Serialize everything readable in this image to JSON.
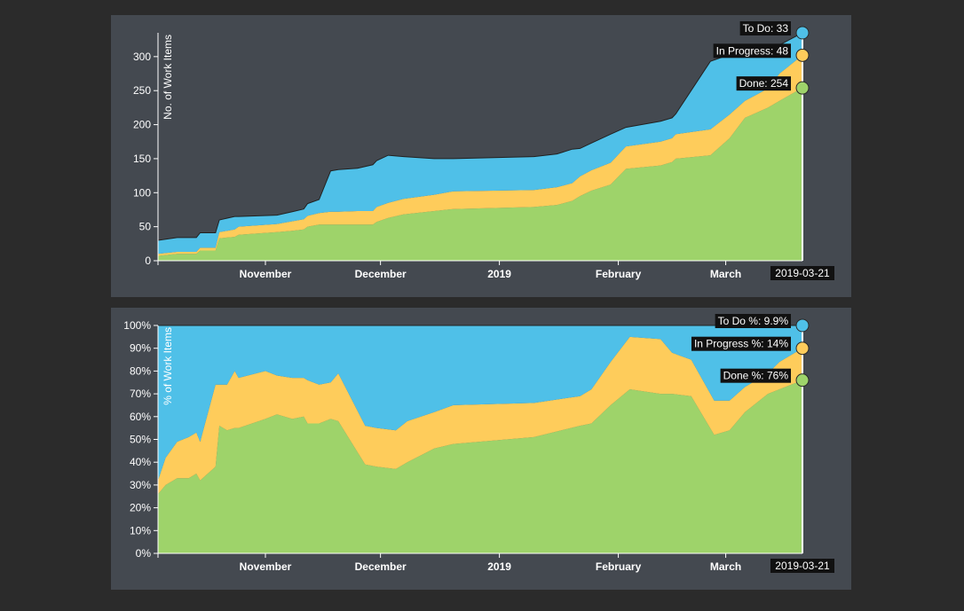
{
  "colors": {
    "page_background": "#2b2b2b",
    "panel_background": "#444950",
    "todo": "#4fc0e8",
    "in_progress": "#fecc5b",
    "done": "#9ed36a",
    "callout_background": "#111111",
    "axis": "#ffffff"
  },
  "chart_data": [
    {
      "type": "area",
      "stacked": true,
      "ylabel": "No. of Work Items",
      "ylim": [
        0,
        335
      ],
      "yticks": [
        0,
        50,
        100,
        150,
        200,
        250,
        300
      ],
      "x_start": "2018-10-04",
      "x_end": "2019-03-21",
      "xticks": [
        {
          "label": "November",
          "date": "2018-11-01"
        },
        {
          "label": "December",
          "date": "2018-12-01"
        },
        {
          "label": "2019",
          "date": "2019-01-01"
        },
        {
          "label": "February",
          "date": "2019-02-01"
        },
        {
          "label": "March",
          "date": "2019-03-01"
        }
      ],
      "end_date_label": "2019-03-21",
      "x": [
        "2018-10-04",
        "2018-10-09",
        "2018-10-14",
        "2018-10-15",
        "2018-10-19",
        "2018-10-20",
        "2018-10-24",
        "2018-10-25",
        "2018-11-04",
        "2018-11-08",
        "2018-11-11",
        "2018-11-12",
        "2018-11-15",
        "2018-11-18",
        "2018-11-20",
        "2018-11-25",
        "2018-11-29",
        "2018-11-30",
        "2018-12-03",
        "2018-12-07",
        "2018-12-15",
        "2018-12-20",
        "2019-01-10",
        "2019-01-16",
        "2019-01-20",
        "2019-01-22",
        "2019-01-25",
        "2019-01-30",
        "2019-02-03",
        "2019-02-12",
        "2019-02-15",
        "2019-02-16",
        "2019-02-25",
        "2019-03-02",
        "2019-03-06",
        "2019-03-12",
        "2019-03-15",
        "2019-03-21"
      ],
      "series": [
        {
          "name": "Done",
          "values": [
            7,
            10,
            10,
            15,
            15,
            33,
            35,
            38,
            42,
            44,
            46,
            50,
            53,
            53,
            53,
            53,
            53,
            57,
            63,
            68,
            73,
            76,
            79,
            82,
            88,
            95,
            103,
            112,
            135,
            140,
            145,
            150,
            155,
            180,
            210,
            225,
            235,
            254
          ]
        },
        {
          "name": "In Progress",
          "values": [
            3,
            3,
            3,
            4,
            4,
            9,
            11,
            12,
            12,
            14,
            15,
            16,
            17,
            19,
            19,
            20,
            20,
            22,
            22,
            23,
            24,
            26,
            25,
            26,
            26,
            29,
            30,
            32,
            33,
            35,
            35,
            36,
            38,
            35,
            25,
            28,
            40,
            48
          ]
        },
        {
          "name": "To Do",
          "values": [
            20,
            21,
            21,
            22,
            22,
            18,
            19,
            15,
            13,
            14,
            15,
            18,
            20,
            60,
            62,
            63,
            68,
            68,
            70,
            62,
            53,
            48,
            49,
            49,
            50,
            41,
            40,
            42,
            28,
            30,
            30,
            30,
            100,
            88,
            67,
            49,
            42,
            33
          ]
        }
      ],
      "callouts": [
        {
          "series": "To Do",
          "text": "To Do: 33"
        },
        {
          "series": "In Progress",
          "text": "In Progress: 48"
        },
        {
          "series": "Done",
          "text": "Done: 254"
        }
      ]
    },
    {
      "type": "area",
      "stacked": true,
      "percent": true,
      "ylabel": "% of Work Items",
      "ylim": [
        0,
        100
      ],
      "yticks": [
        0,
        10,
        20,
        30,
        40,
        50,
        60,
        70,
        80,
        90,
        100
      ],
      "ytick_suffix": "%",
      "x_start": "2018-10-04",
      "x_end": "2019-03-21",
      "xticks": [
        {
          "label": "November",
          "date": "2018-11-01"
        },
        {
          "label": "December",
          "date": "2018-12-01"
        },
        {
          "label": "2019",
          "date": "2019-01-01"
        },
        {
          "label": "February",
          "date": "2019-02-01"
        },
        {
          "label": "March",
          "date": "2019-03-01"
        }
      ],
      "end_date_label": "2019-03-21",
      "x": [
        "2018-10-04",
        "2018-10-06",
        "2018-10-09",
        "2018-10-12",
        "2018-10-14",
        "2018-10-15",
        "2018-10-19",
        "2018-10-20",
        "2018-10-22",
        "2018-10-24",
        "2018-10-25",
        "2018-11-01",
        "2018-11-04",
        "2018-11-08",
        "2018-11-11",
        "2018-11-12",
        "2018-11-15",
        "2018-11-18",
        "2018-11-20",
        "2018-11-27",
        "2018-11-30",
        "2018-12-05",
        "2018-12-08",
        "2018-12-15",
        "2018-12-20",
        "2019-01-10",
        "2019-01-22",
        "2019-01-25",
        "2019-01-30",
        "2019-02-04",
        "2019-02-12",
        "2019-02-15",
        "2019-02-20",
        "2019-02-26",
        "2019-03-02",
        "2019-03-06",
        "2019-03-12",
        "2019-03-15",
        "2019-03-21"
      ],
      "series": [
        {
          "name": "Done",
          "values": [
            26,
            30,
            33,
            33,
            35,
            32,
            38,
            56,
            54,
            55,
            55,
            59,
            61,
            59,
            60,
            57,
            57,
            59,
            58,
            39,
            38,
            37,
            40,
            46,
            48,
            51,
            56,
            57,
            65,
            72,
            70,
            70,
            69,
            52,
            54,
            62,
            70,
            72,
            76
          ]
        },
        {
          "name": "In Progress",
          "values": [
            6,
            12,
            16,
            18,
            18,
            17,
            36,
            18,
            20,
            25,
            22,
            21,
            17,
            18,
            17,
            19,
            17,
            16,
            21,
            17,
            17,
            17,
            18,
            16,
            17,
            15,
            13,
            15,
            19,
            23,
            24,
            18,
            16,
            15,
            13,
            11,
            9,
            12,
            14
          ]
        },
        {
          "name": "To Do",
          "values": [
            68,
            58,
            51,
            49,
            47,
            51,
            26,
            26,
            26,
            20,
            23,
            20,
            22,
            23,
            23,
            24,
            26,
            25,
            21,
            44,
            45,
            46,
            42,
            38,
            35,
            34,
            31,
            28,
            16,
            5,
            6,
            12,
            15,
            33,
            33,
            27,
            21,
            16,
            10
          ]
        }
      ],
      "callouts": [
        {
          "series": "To Do",
          "text": "To Do %: 9.9%"
        },
        {
          "series": "In Progress",
          "text": "In Progress %: 14%"
        },
        {
          "series": "Done",
          "text": "Done %: 76%"
        }
      ]
    }
  ]
}
